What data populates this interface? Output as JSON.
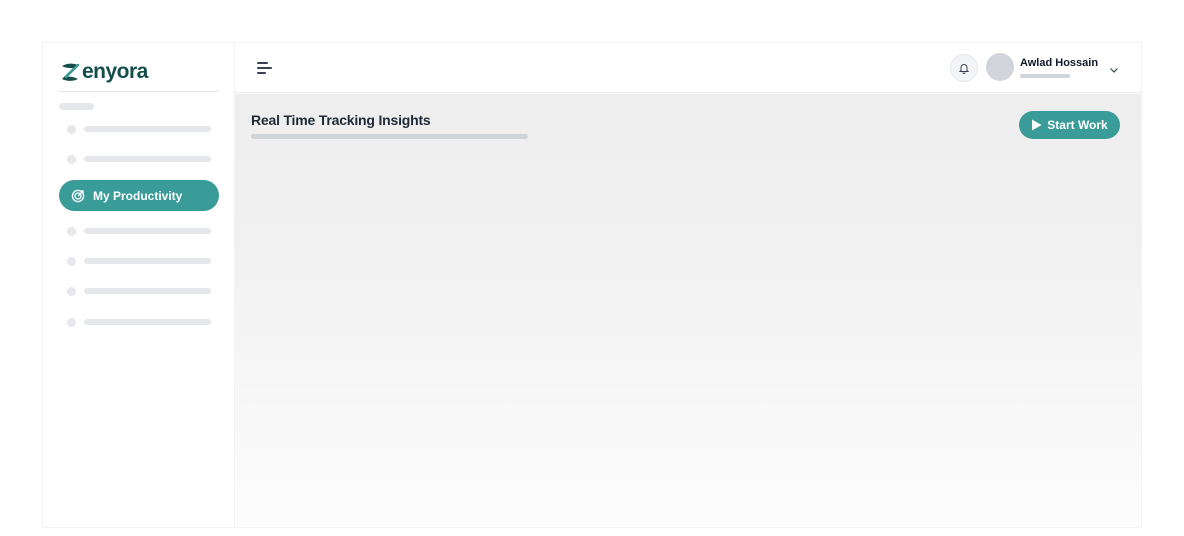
{
  "brand": {
    "name": "enyora",
    "accent": "#134e4a"
  },
  "sidebar": {
    "active_item": {
      "label": "My Productivity",
      "icon": "target-icon",
      "color": "#3a9c98"
    }
  },
  "header": {
    "menu_icon": "menu-icon",
    "notification_icon": "bell-icon",
    "user": {
      "name": "Awlad Hossain",
      "dropdown_icon": "chevron-down-icon"
    }
  },
  "main": {
    "title": "Real Time Tracking Insights",
    "start_button": {
      "label": "Start Work",
      "icon": "play-icon",
      "color": "#3a9c98"
    }
  }
}
